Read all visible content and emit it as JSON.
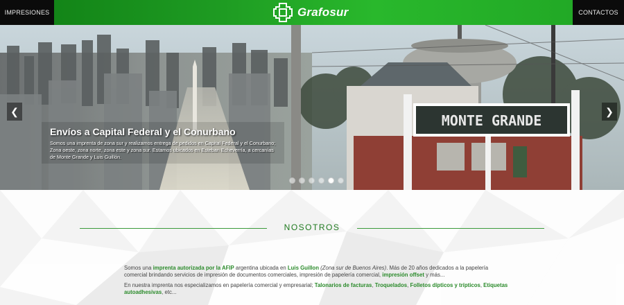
{
  "nav": {
    "left_label": "IMPRESIONES",
    "right_label": "CONTACTOS"
  },
  "logo": {
    "text": "Grafosur",
    "icon": "grafosur-logo-icon"
  },
  "hero": {
    "caption_title": "Envíos a Capital Federal y el Conurbano",
    "caption_body": "Somos una imprenta de zona sur y realizamos entrega de pedidos en Capital Federal y el Conurbano; Zona oeste, zona norte, zona este y zona sur. Estamos ubicados en Esteban Echeverría, a cercanías de Monte Grande y Luis Guillón.",
    "station_sign": "MONTE GRANDE",
    "prev_icon": "chevron-left-icon",
    "next_icon": "chevron-right-icon",
    "dots": 6,
    "active_dot": 5
  },
  "section": {
    "title": "NOSOTROS",
    "p1": {
      "t1": "Somos una ",
      "h1": "imprenta autorizada por la AFIP",
      "t2": " argentina ubicada en ",
      "h2": "Luis Guillon",
      "t3": " ",
      "i1": "(Zona sur de Buenos Aires)",
      "t4": ". Más de 20 años dedicados a la papelería comercial brindando servicios de impresión de documentos comerciales, impresión de papelería comercial, ",
      "h3": "impresión offset",
      "t5": " y más..."
    },
    "p2": {
      "t1": "En nuestra imprenta nos especializamos en papelería comercial y empresarial; ",
      "h1": "Talonarios de facturas",
      "s1": ", ",
      "h2": "Troquelados",
      "s2": ", ",
      "h3": "Folletos dípticos y trípticos",
      "s3": ", ",
      "h4": "Etiquetas autoadhesivas",
      "t2": ", etc..."
    }
  },
  "colors": {
    "brand_green": "#1e9b22",
    "nav_black": "#0b0b0b",
    "accent_text": "#2a8a2a"
  }
}
